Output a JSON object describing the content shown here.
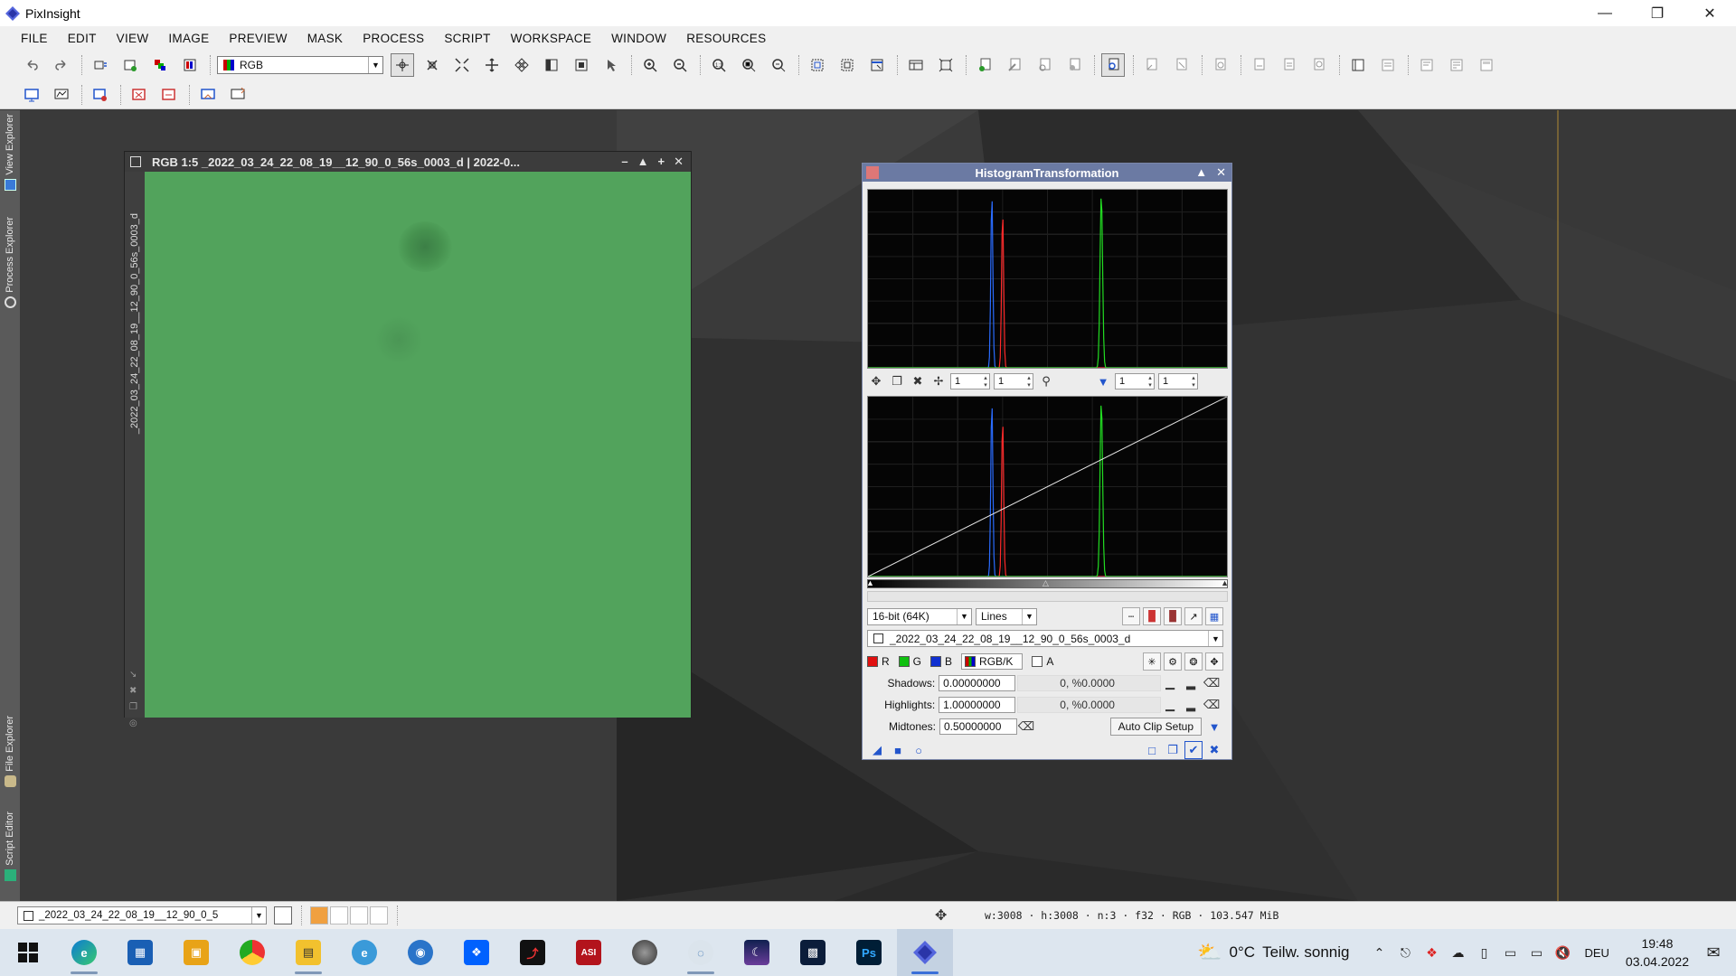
{
  "app": {
    "title": "PixInsight"
  },
  "menu": [
    "FILE",
    "EDIT",
    "VIEW",
    "IMAGE",
    "PREVIEW",
    "MASK",
    "PROCESS",
    "SCRIPT",
    "WORKSPACE",
    "WINDOW",
    "RESOURCES"
  ],
  "toolbar": {
    "channel_select": "RGB"
  },
  "side_tabs": {
    "view_explorer": "View Explorer",
    "process_explorer": "Process Explorer",
    "file_explorer": "File Explorer",
    "script_editor": "Script Editor"
  },
  "image_window": {
    "title": "RGB 1:5 _2022_03_24_22_08_19__12_90_0_56s_0003_d | 2022-0...",
    "side_title": "_2022_03_24_22_08_19__12_90_0_56s_0003_d",
    "fill_color": "#52a35c"
  },
  "histogram": {
    "title": "HistogramTransformation",
    "zoom_values": [
      "1",
      "1",
      "1",
      "1"
    ],
    "resolution": "16-bit (64K)",
    "graph_style": "Lines",
    "view": "_2022_03_24_22_08_19__12_90_0_56s_0003_d",
    "channels": [
      {
        "label": "R",
        "color": "#e01010"
      },
      {
        "label": "G",
        "color": "#10c010"
      },
      {
        "label": "B",
        "color": "#1030d0"
      },
      {
        "label": "RGB/K",
        "color": "#888888"
      },
      {
        "label": "A",
        "color": "#ffffff"
      }
    ],
    "shadows_label": "Shadows:",
    "shadows_value": "0.00000000",
    "shadows_clip": "0, %0.0000",
    "highlights_label": "Highlights:",
    "highlights_value": "1.00000000",
    "highlights_clip": "0, %0.0000",
    "midtones_label": "Midtones:",
    "midtones_value": "0.50000000",
    "auto_clip": "Auto Clip Setup",
    "peaks": {
      "blue": 0.345,
      "red": 0.375,
      "green": 0.65
    }
  },
  "statusbar": {
    "view_select": "_2022_03_24_22_08_19__12_90_0_5",
    "info": "w:3008 · h:3008 · n:3 · f32 · RGB · 103.547 MiB"
  },
  "taskbar": {
    "weather_temp": "0°C",
    "weather_text": "Teilw. sonnig",
    "language": "DEU",
    "time": "19:48",
    "date": "03.04.2022"
  }
}
